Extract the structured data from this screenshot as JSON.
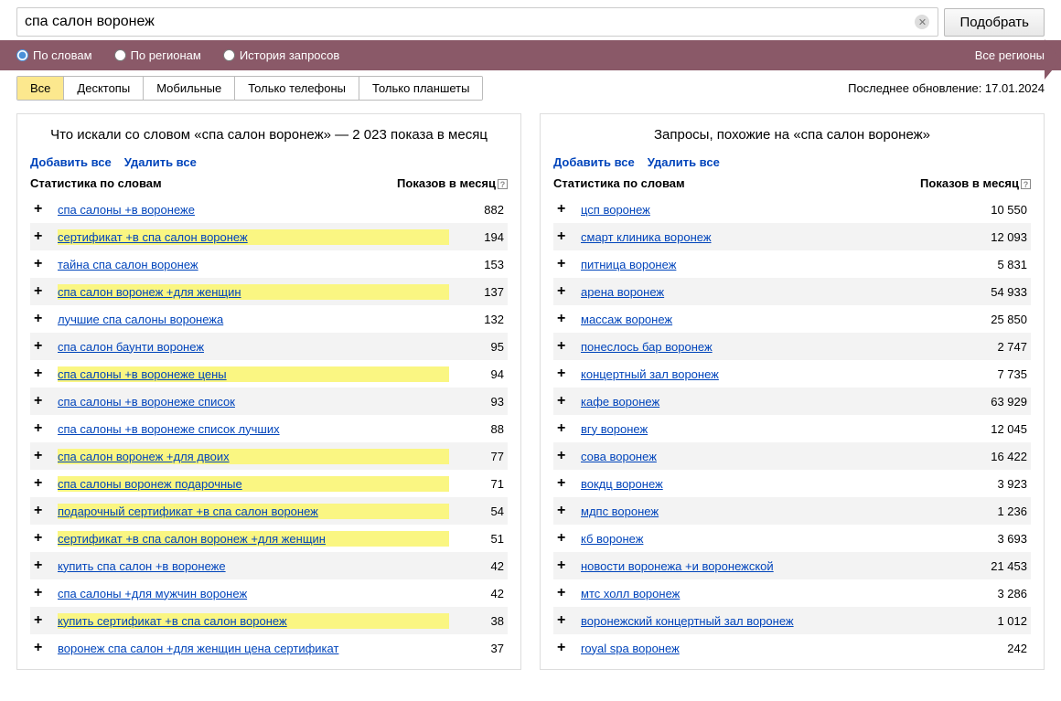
{
  "search": {
    "value": "спа салон воронеж",
    "button": "Подобрать"
  },
  "filters": {
    "radios": [
      "По словам",
      "По регионам",
      "История запросов"
    ],
    "selected": 0,
    "allRegions": "Все регионы"
  },
  "tabs": {
    "items": [
      "Все",
      "Десктопы",
      "Мобильные",
      "Только телефоны",
      "Только планшеты"
    ],
    "active": 0
  },
  "lastUpdate": "Последнее обновление: 17.01.2024",
  "leftPanel": {
    "title": "Что искали со словом «спа салон воронеж» — 2 023 показа в месяц",
    "addAll": "Добавить все",
    "removeAll": "Удалить все",
    "colStats": "Статистика по словам",
    "colShows": "Показов в месяц",
    "rows": [
      {
        "kw": "спа салоны +в воронеже",
        "n": "882",
        "hl": false
      },
      {
        "kw": "сертификат +в спа салон воронеж",
        "n": "194",
        "hl": true
      },
      {
        "kw": "тайна спа салон воронеж",
        "n": "153",
        "hl": false
      },
      {
        "kw": "спа салон воронеж +для женщин",
        "n": "137",
        "hl": true
      },
      {
        "kw": "лучшие спа салоны воронежа",
        "n": "132",
        "hl": false
      },
      {
        "kw": "спа салон баунти воронеж",
        "n": "95",
        "hl": false
      },
      {
        "kw": "спа салоны +в воронеже цены",
        "n": "94",
        "hl": true
      },
      {
        "kw": "спа салоны +в воронеже список",
        "n": "93",
        "hl": false
      },
      {
        "kw": "спа салоны +в воронеже список лучших",
        "n": "88",
        "hl": false
      },
      {
        "kw": "спа салон воронеж +для двоих",
        "n": "77",
        "hl": true
      },
      {
        "kw": "спа салоны воронеж подарочные",
        "n": "71",
        "hl": true
      },
      {
        "kw": "подарочный сертификат +в спа салон воронеж",
        "n": "54",
        "hl": true
      },
      {
        "kw": "сертификат +в спа салон воронеж +для женщин",
        "n": "51",
        "hl": true
      },
      {
        "kw": "купить спа салон +в воронеже",
        "n": "42",
        "hl": false
      },
      {
        "kw": "спа салоны +для мужчин воронеж",
        "n": "42",
        "hl": false
      },
      {
        "kw": "купить сертификат +в спа салон воронеж",
        "n": "38",
        "hl": true
      },
      {
        "kw": "воронеж спа салон +для женщин цена сертификат",
        "n": "37",
        "hl": false
      }
    ]
  },
  "rightPanel": {
    "title": "Запросы, похожие на «спа салон воронеж»",
    "addAll": "Добавить все",
    "removeAll": "Удалить все",
    "colStats": "Статистика по словам",
    "colShows": "Показов в месяц",
    "rows": [
      {
        "kw": "цсп воронеж",
        "n": "10 550"
      },
      {
        "kw": "смарт клиника воронеж",
        "n": "12 093"
      },
      {
        "kw": "питница воронеж",
        "n": "5 831"
      },
      {
        "kw": "арена воронеж",
        "n": "54 933"
      },
      {
        "kw": "массаж воронеж",
        "n": "25 850"
      },
      {
        "kw": "понеслось бар воронеж",
        "n": "2 747"
      },
      {
        "kw": "концертный зал воронеж",
        "n": "7 735"
      },
      {
        "kw": "кафе воронеж",
        "n": "63 929"
      },
      {
        "kw": "вгу воронеж",
        "n": "12 045"
      },
      {
        "kw": "сова воронеж",
        "n": "16 422"
      },
      {
        "kw": "вокдц воронеж",
        "n": "3 923"
      },
      {
        "kw": "мдпс воронеж",
        "n": "1 236"
      },
      {
        "kw": "кб воронеж",
        "n": "3 693"
      },
      {
        "kw": "новости воронежа +и воронежской",
        "n": "21 453"
      },
      {
        "kw": "мтс холл воронеж",
        "n": "3 286"
      },
      {
        "kw": "воронежский концертный зал воронеж",
        "n": "1 012"
      },
      {
        "kw": "royal spa воронеж",
        "n": "242"
      }
    ]
  }
}
